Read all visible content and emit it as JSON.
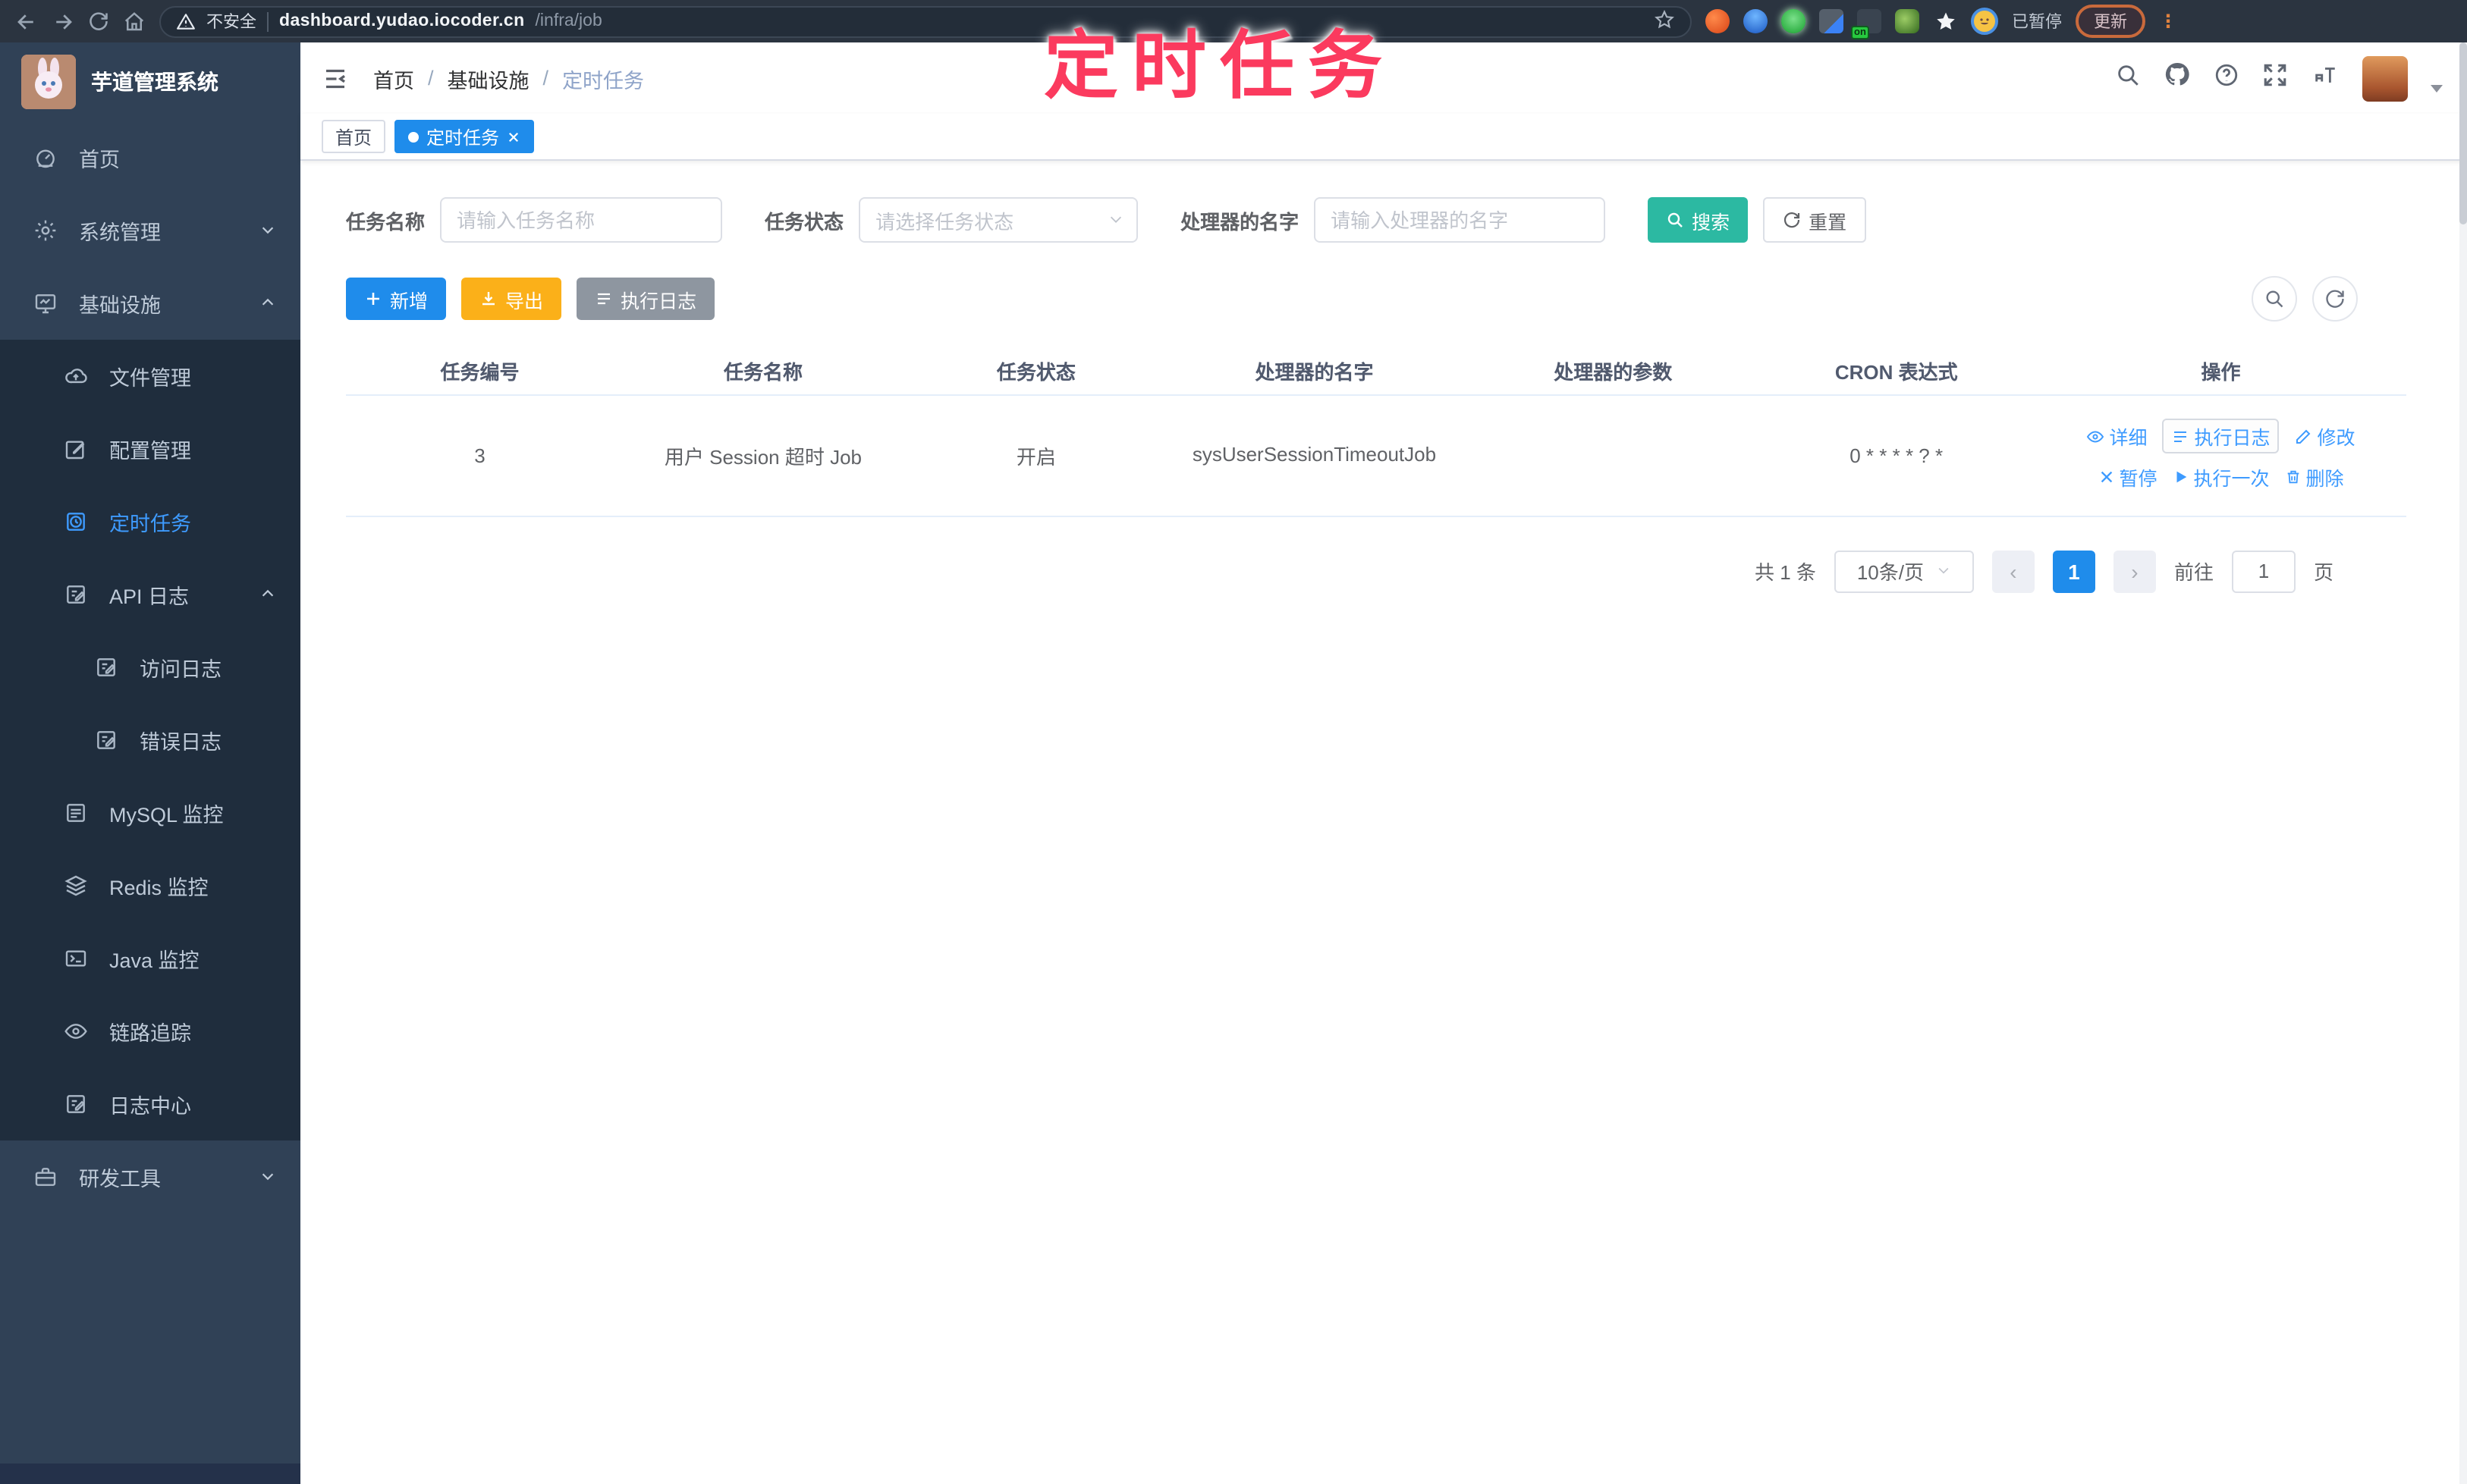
{
  "browser": {
    "security_label": "不安全",
    "url_domain": "dashboard.yudao.iocoder.cn",
    "url_path": "/infra/job",
    "extension_on_badge": "on",
    "paused_label": "已暂停",
    "update_label": "更新",
    "kebab": "⋮"
  },
  "annotation": {
    "text": "定时任务",
    "color": "#fb3a5e"
  },
  "sidebar": {
    "app_title": "芋道管理系统",
    "items": [
      {
        "label": "首页"
      },
      {
        "label": "系统管理"
      },
      {
        "label": "基础设施"
      },
      {
        "label": "文件管理"
      },
      {
        "label": "配置管理"
      },
      {
        "label": "定时任务"
      },
      {
        "label": "API 日志"
      },
      {
        "label": "访问日志"
      },
      {
        "label": "错误日志"
      },
      {
        "label": "MySQL 监控"
      },
      {
        "label": "Redis 监控"
      },
      {
        "label": "Java 监控"
      },
      {
        "label": "链路追踪"
      },
      {
        "label": "日志中心"
      },
      {
        "label": "研发工具"
      }
    ]
  },
  "breadcrumb": {
    "items": [
      "首页",
      "基础设施",
      "定时任务"
    ],
    "sep": "/"
  },
  "tabs": [
    {
      "label": "首页"
    },
    {
      "label": "定时任务"
    }
  ],
  "filters": {
    "name_label": "任务名称",
    "name_placeholder": "请输入任务名称",
    "status_label": "任务状态",
    "status_placeholder": "请选择任务状态",
    "handler_label": "处理器的名字",
    "handler_placeholder": "请输入处理器的名字",
    "search_label": "搜索",
    "reset_label": "重置"
  },
  "toolbar": {
    "add_label": "新增",
    "export_label": "导出",
    "runlog_label": "执行日志"
  },
  "table": {
    "headers": [
      "任务编号",
      "任务名称",
      "任务状态",
      "处理器的名字",
      "处理器的参数",
      "CRON 表达式",
      "操作"
    ],
    "rows": [
      {
        "id": "3",
        "name": "用户 Session 超时 Job",
        "status": "开启",
        "handler": "sysUserSessionTimeoutJob",
        "param": "",
        "cron": "0 * * * * ? *"
      }
    ]
  },
  "actions": {
    "detail": "详细",
    "run_log": "执行日志",
    "edit": "修改",
    "pause": "暂停",
    "run_once": "执行一次",
    "delete": "删除"
  },
  "pagination": {
    "total": "共 1 条",
    "page_size": "10条/页",
    "prev": "‹",
    "page": "1",
    "next": "›",
    "goto_label": "前往",
    "goto_value": "1",
    "unit_label": "页"
  },
  "colors": {
    "accent_blue": "#1f8ceb",
    "link_blue": "#3e9bff",
    "teal": "#2cb9a2",
    "orange": "#fbb019",
    "gray_btn": "#8e96a0",
    "annotation_pink": "#fb3a5e",
    "sidebar_bg": "#304156",
    "submenu_bg": "#1f2d3d",
    "active_menu": "#3e9bff"
  }
}
